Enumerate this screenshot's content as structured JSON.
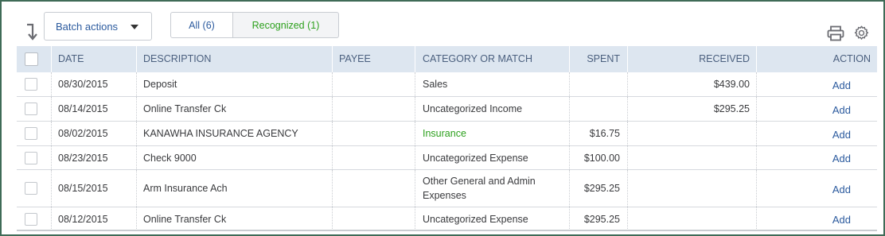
{
  "toolbar": {
    "batch_actions_label": "Batch actions",
    "tabs": [
      {
        "label": "All (6)"
      },
      {
        "label": "Recognized (1)"
      }
    ]
  },
  "table": {
    "headers": {
      "date": "DATE",
      "description": "DESCRIPTION",
      "payee": "PAYEE",
      "category": "CATEGORY OR MATCH",
      "spent": "SPENT",
      "received": "RECEIVED",
      "action": "ACTION"
    },
    "rows": [
      {
        "date": "08/30/2015",
        "description": "Deposit",
        "payee": "",
        "category": "Sales",
        "category_line2": "",
        "category_recognized": false,
        "spent": "",
        "received": "$439.00",
        "action": "Add"
      },
      {
        "date": "08/14/2015",
        "description": "Online Transfer Ck",
        "payee": "",
        "category": "Uncategorized Income",
        "category_line2": "",
        "category_recognized": false,
        "spent": "",
        "received": "$295.25",
        "action": "Add"
      },
      {
        "date": "08/02/2015",
        "description": "KANAWHA INSURANCE AGENCY",
        "payee": "",
        "category": "Insurance",
        "category_line2": "",
        "category_recognized": true,
        "spent": "$16.75",
        "received": "",
        "action": "Add"
      },
      {
        "date": "08/23/2015",
        "description": "Check 9000",
        "payee": "",
        "category": "Uncategorized Expense",
        "category_line2": "",
        "category_recognized": false,
        "spent": "$100.00",
        "received": "",
        "action": "Add"
      },
      {
        "date": "08/15/2015",
        "description": "Arm Insurance Ach",
        "payee": "",
        "category": "Other General and Admin",
        "category_line2": "Expenses",
        "category_recognized": false,
        "spent": "$295.25",
        "received": "",
        "action": "Add"
      },
      {
        "date": "08/12/2015",
        "description": "Online Transfer Ck",
        "payee": "",
        "category": "Uncategorized Expense",
        "category_line2": "",
        "category_recognized": false,
        "spent": "$295.25",
        "received": "",
        "action": "Add"
      }
    ]
  },
  "colors": {
    "link": "#2b5a9e",
    "recognized": "#2ca01c",
    "header_bg": "#dde6f0",
    "frame_border": "#3f6b57"
  },
  "icons": [
    "sort-arrow-icon",
    "chevron-down-icon",
    "print-icon",
    "gear-icon"
  ]
}
